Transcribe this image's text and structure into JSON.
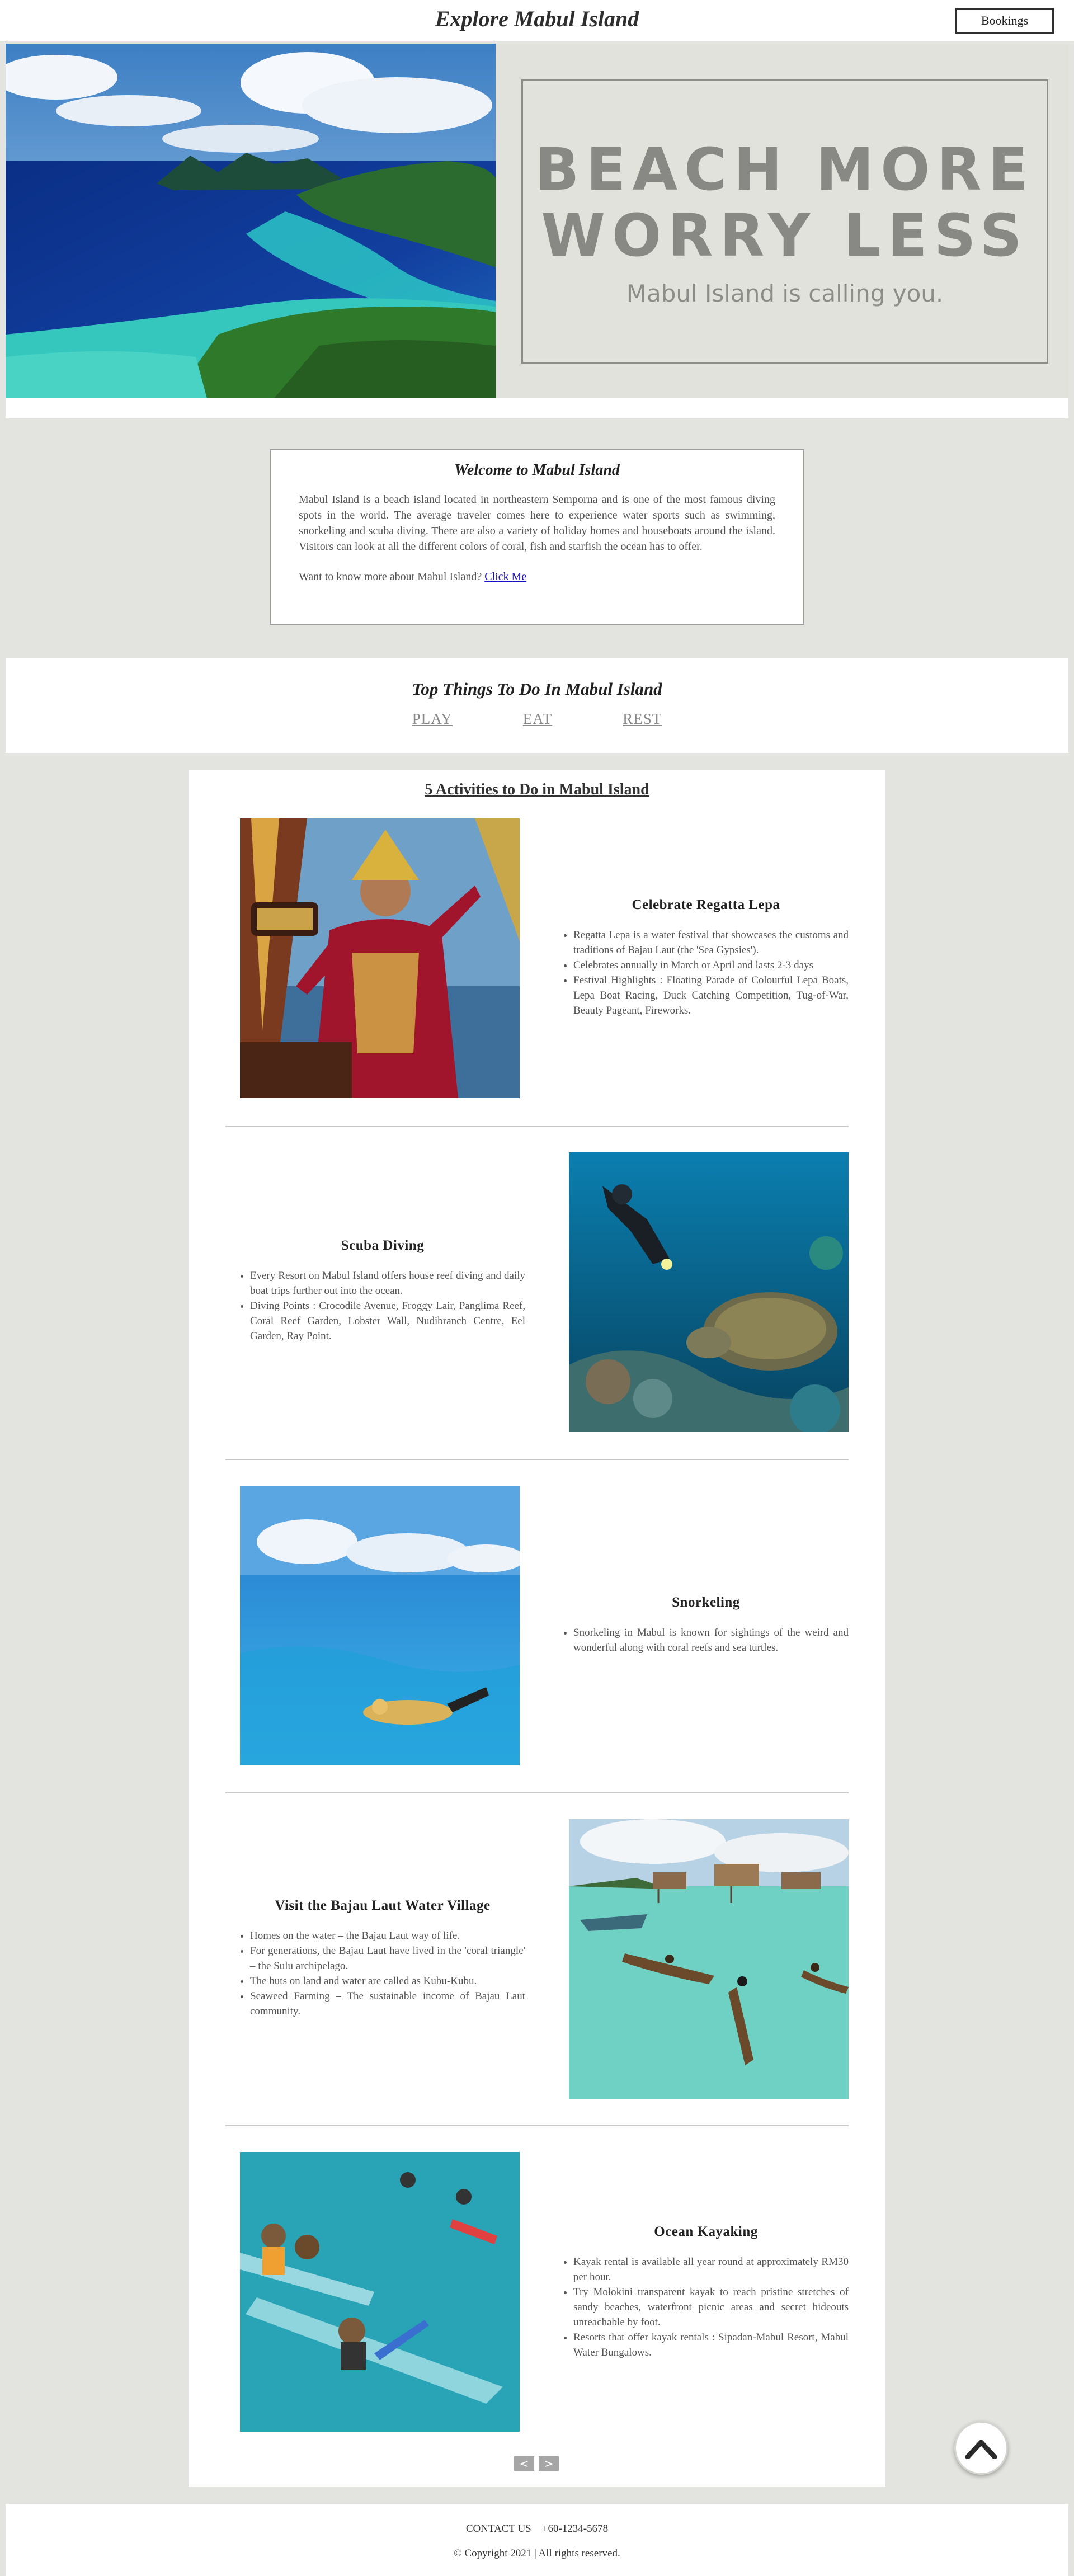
{
  "header": {
    "title": "Explore Mabul Island",
    "bookings_label": "Bookings"
  },
  "hero": {
    "line1": "BEACH MORE",
    "line2": "WORRY LESS",
    "subtitle": "Mabul Island is calling you."
  },
  "welcome": {
    "title": "Welcome to Mabul Island",
    "body": "Mabul Island is a beach island located in northeastern Semporna and is one of the most famous diving spots in the world. The average traveler comes here to experience water sports such as swimming, snorkeling and scuba diving. There are also a variety of holiday homes and houseboats around the island. Visitors can look at all the different colors of coral, fish and starfish the ocean has to offer.",
    "know_more": "Want to know more about Mabul Island?",
    "link": "Click Me"
  },
  "top_things": {
    "title": "Top Things To Do In Mabul Island",
    "tabs": [
      "PLAY",
      "EAT",
      "REST"
    ]
  },
  "activities": {
    "title": "5 Activities to Do in Mabul Island",
    "items": [
      {
        "title": "Celebrate Regatta Lepa",
        "bullets": [
          "Regatta Lepa is a water festival that showcases the customs and traditions of Bajau Laut (the 'Sea Gypsies').",
          "Celebrates annually in March or April and lasts 2-3 days",
          "Festival Highlights : Floating Parade of Colourful Lepa Boats, Lepa Boat Racing, Duck Catching Competition, Tug-of-War, Beauty Pageant, Fireworks."
        ]
      },
      {
        "title": "Scuba Diving",
        "bullets": [
          "Every Resort on Mabul Island offers house reef diving and daily boat trips further out into the ocean.",
          "Diving Points : Crocodile Avenue, Froggy Lair, Panglima Reef, Coral Reef Garden, Lobster Wall, Nudibranch Centre, Eel Garden, Ray Point."
        ]
      },
      {
        "title": "Snorkeling",
        "bullets": [
          "Snorkeling in Mabul is known for sightings of the weird and wonderful along with coral reefs and sea turtles."
        ]
      },
      {
        "title": "Visit the Bajau Laut Water Village",
        "bullets": [
          "Homes on the water – the Bajau Laut way of life.",
          "For generations, the Bajau Laut have lived in the 'coral triangle' – the Sulu archipelago.",
          "The huts on land and water are called as Kubu-Kubu.",
          "Seaweed Farming – The sustainable income of Bajau Laut community."
        ]
      },
      {
        "title": "Ocean Kayaking",
        "bullets": [
          "Kayak rental is available all year round at approximately RM30 per hour.",
          "Try Molokini transparent kayak to reach pristine stretches of sandy beaches, waterfront picnic areas and secret hideouts unreachable by foot.",
          "Resorts that offer kayak rentals : Sipadan-Mabul Resort, Mabul Water Bungalows."
        ]
      }
    ],
    "pager_prev": "<",
    "pager_next": ">"
  },
  "footer": {
    "contact_label": "CONTACT US",
    "phone": "+60-1234-5678",
    "copyright": "© Copyright 2021 | All rights reserved."
  },
  "icons": {
    "back_to_top": "chevron-up-icon"
  }
}
